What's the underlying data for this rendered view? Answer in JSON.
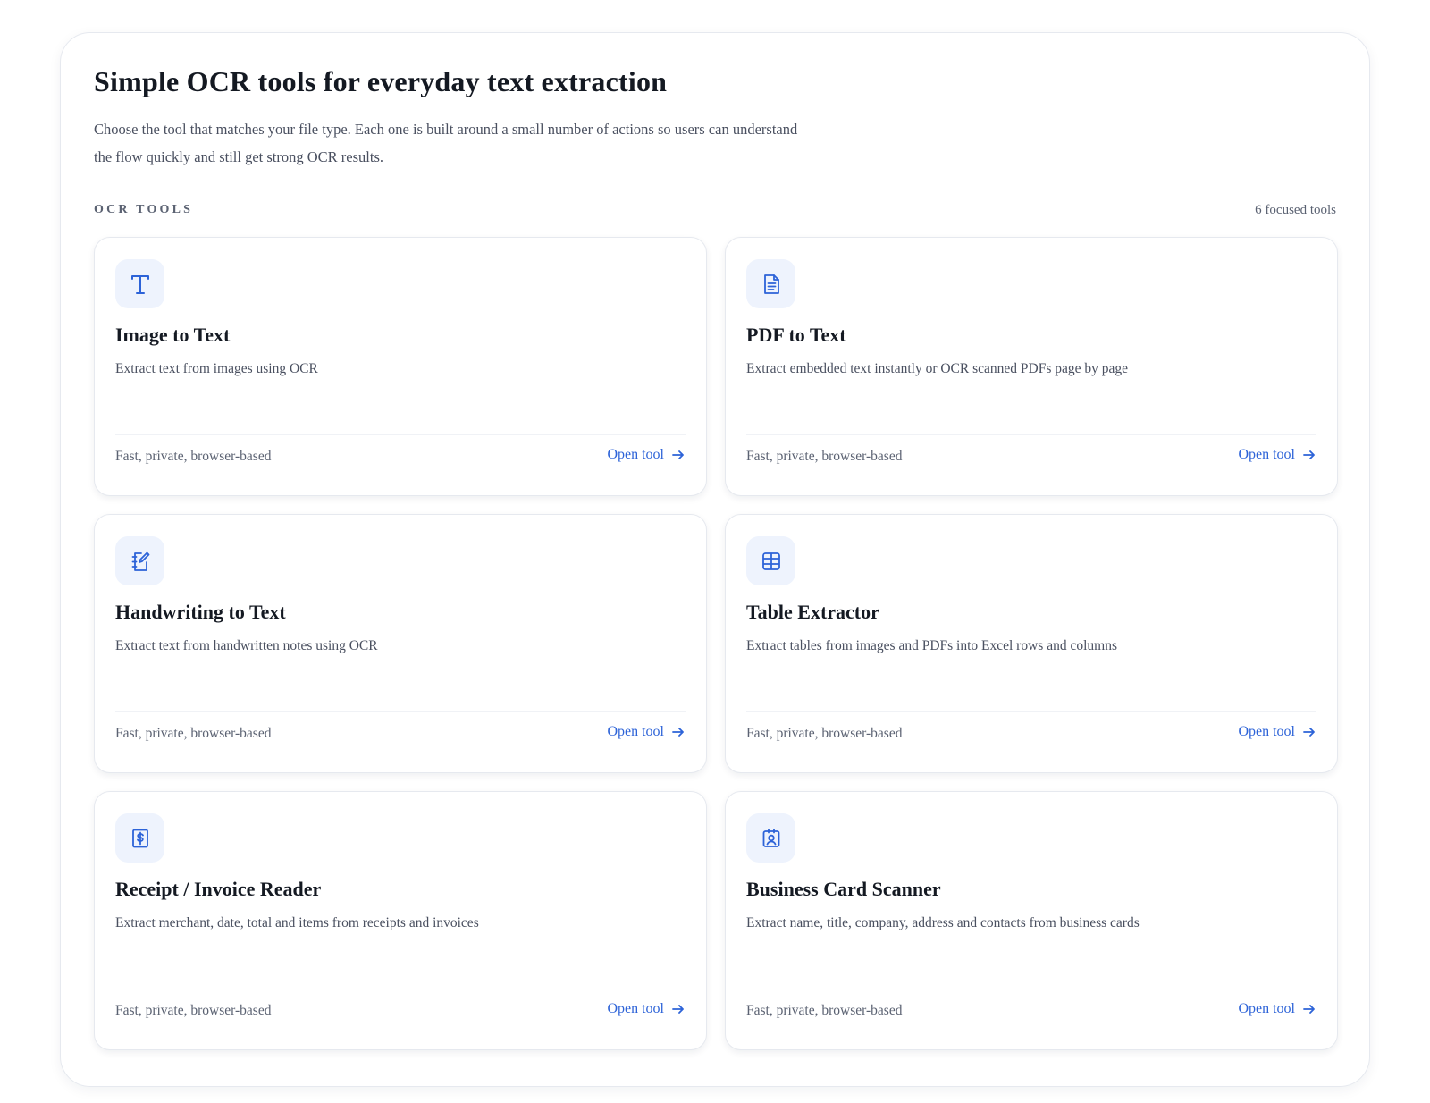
{
  "header": {
    "title": "Simple OCR tools for everyday text extraction",
    "intro_line1": "Choose the tool that matches your file type. Each one is built around a small number of actions so users can understand",
    "intro_line2": "the flow quickly and still get strong OCR results."
  },
  "section": {
    "label": "OCR TOOLS",
    "count": "6 focused tools"
  },
  "colors": {
    "accent": "#2d63d8",
    "icon_background": "#eef3fd"
  },
  "tools": [
    {
      "title": "Image to Text",
      "description": "Extract text from images using OCR",
      "note": "Fast, private, browser-based",
      "link": "Open tool",
      "icon": "text-t-icon"
    },
    {
      "title": "PDF to Text",
      "description": "Extract embedded text instantly or OCR scanned PDFs page by page",
      "note": "Fast, private, browser-based",
      "link": "Open tool",
      "icon": "document-icon"
    },
    {
      "title": "Handwriting to Text",
      "description": "Extract text from handwritten notes using OCR",
      "note": "Fast, private, browser-based",
      "link": "Open tool",
      "icon": "notebook-pen-icon"
    },
    {
      "title": "Table Extractor",
      "description": "Extract tables from images and PDFs into Excel rows and columns",
      "note": "Fast, private, browser-based",
      "link": "Open tool",
      "icon": "table-icon"
    },
    {
      "title": "Receipt / Invoice Reader",
      "description": "Extract merchant, date, total and items from receipts and invoices",
      "note": "Fast, private, browser-based",
      "link": "Open tool",
      "icon": "receipt-dollar-icon"
    },
    {
      "title": "Business Card Scanner",
      "description": "Extract name, title, company, address and contacts from business cards",
      "note": "Fast, private, browser-based",
      "link": "Open tool",
      "icon": "contact-card-icon"
    }
  ]
}
